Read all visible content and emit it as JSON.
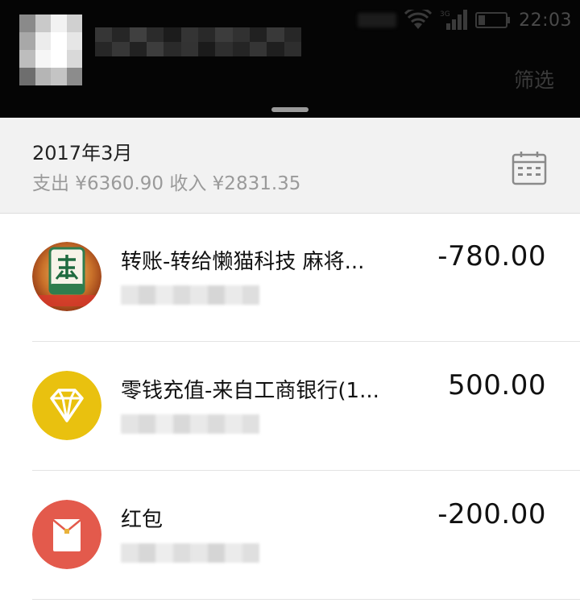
{
  "status_bar": {
    "time": "22:03",
    "network_badge": "3G"
  },
  "header": {
    "filter_label": "筛选"
  },
  "month": {
    "title": "2017年3月",
    "summary": "支出 ¥6360.90 收入 ¥2831.35"
  },
  "transactions": [
    {
      "title": "转账-转给懒猫科技 麻将...",
      "amount": "-780.00",
      "icon": "mahjong-app-icon"
    },
    {
      "title": "零钱充值-来自工商银行(1...",
      "amount": "500.00",
      "icon": "diamond-icon"
    },
    {
      "title": "红包",
      "amount": "-200.00",
      "icon": "red-packet-icon"
    }
  ],
  "colors": {
    "header_bg": "#050505",
    "month_bar_bg": "#f2f2f2",
    "diamond_icon_bg": "#e9c10f",
    "red_packet_icon_bg": "#e35a4c"
  }
}
